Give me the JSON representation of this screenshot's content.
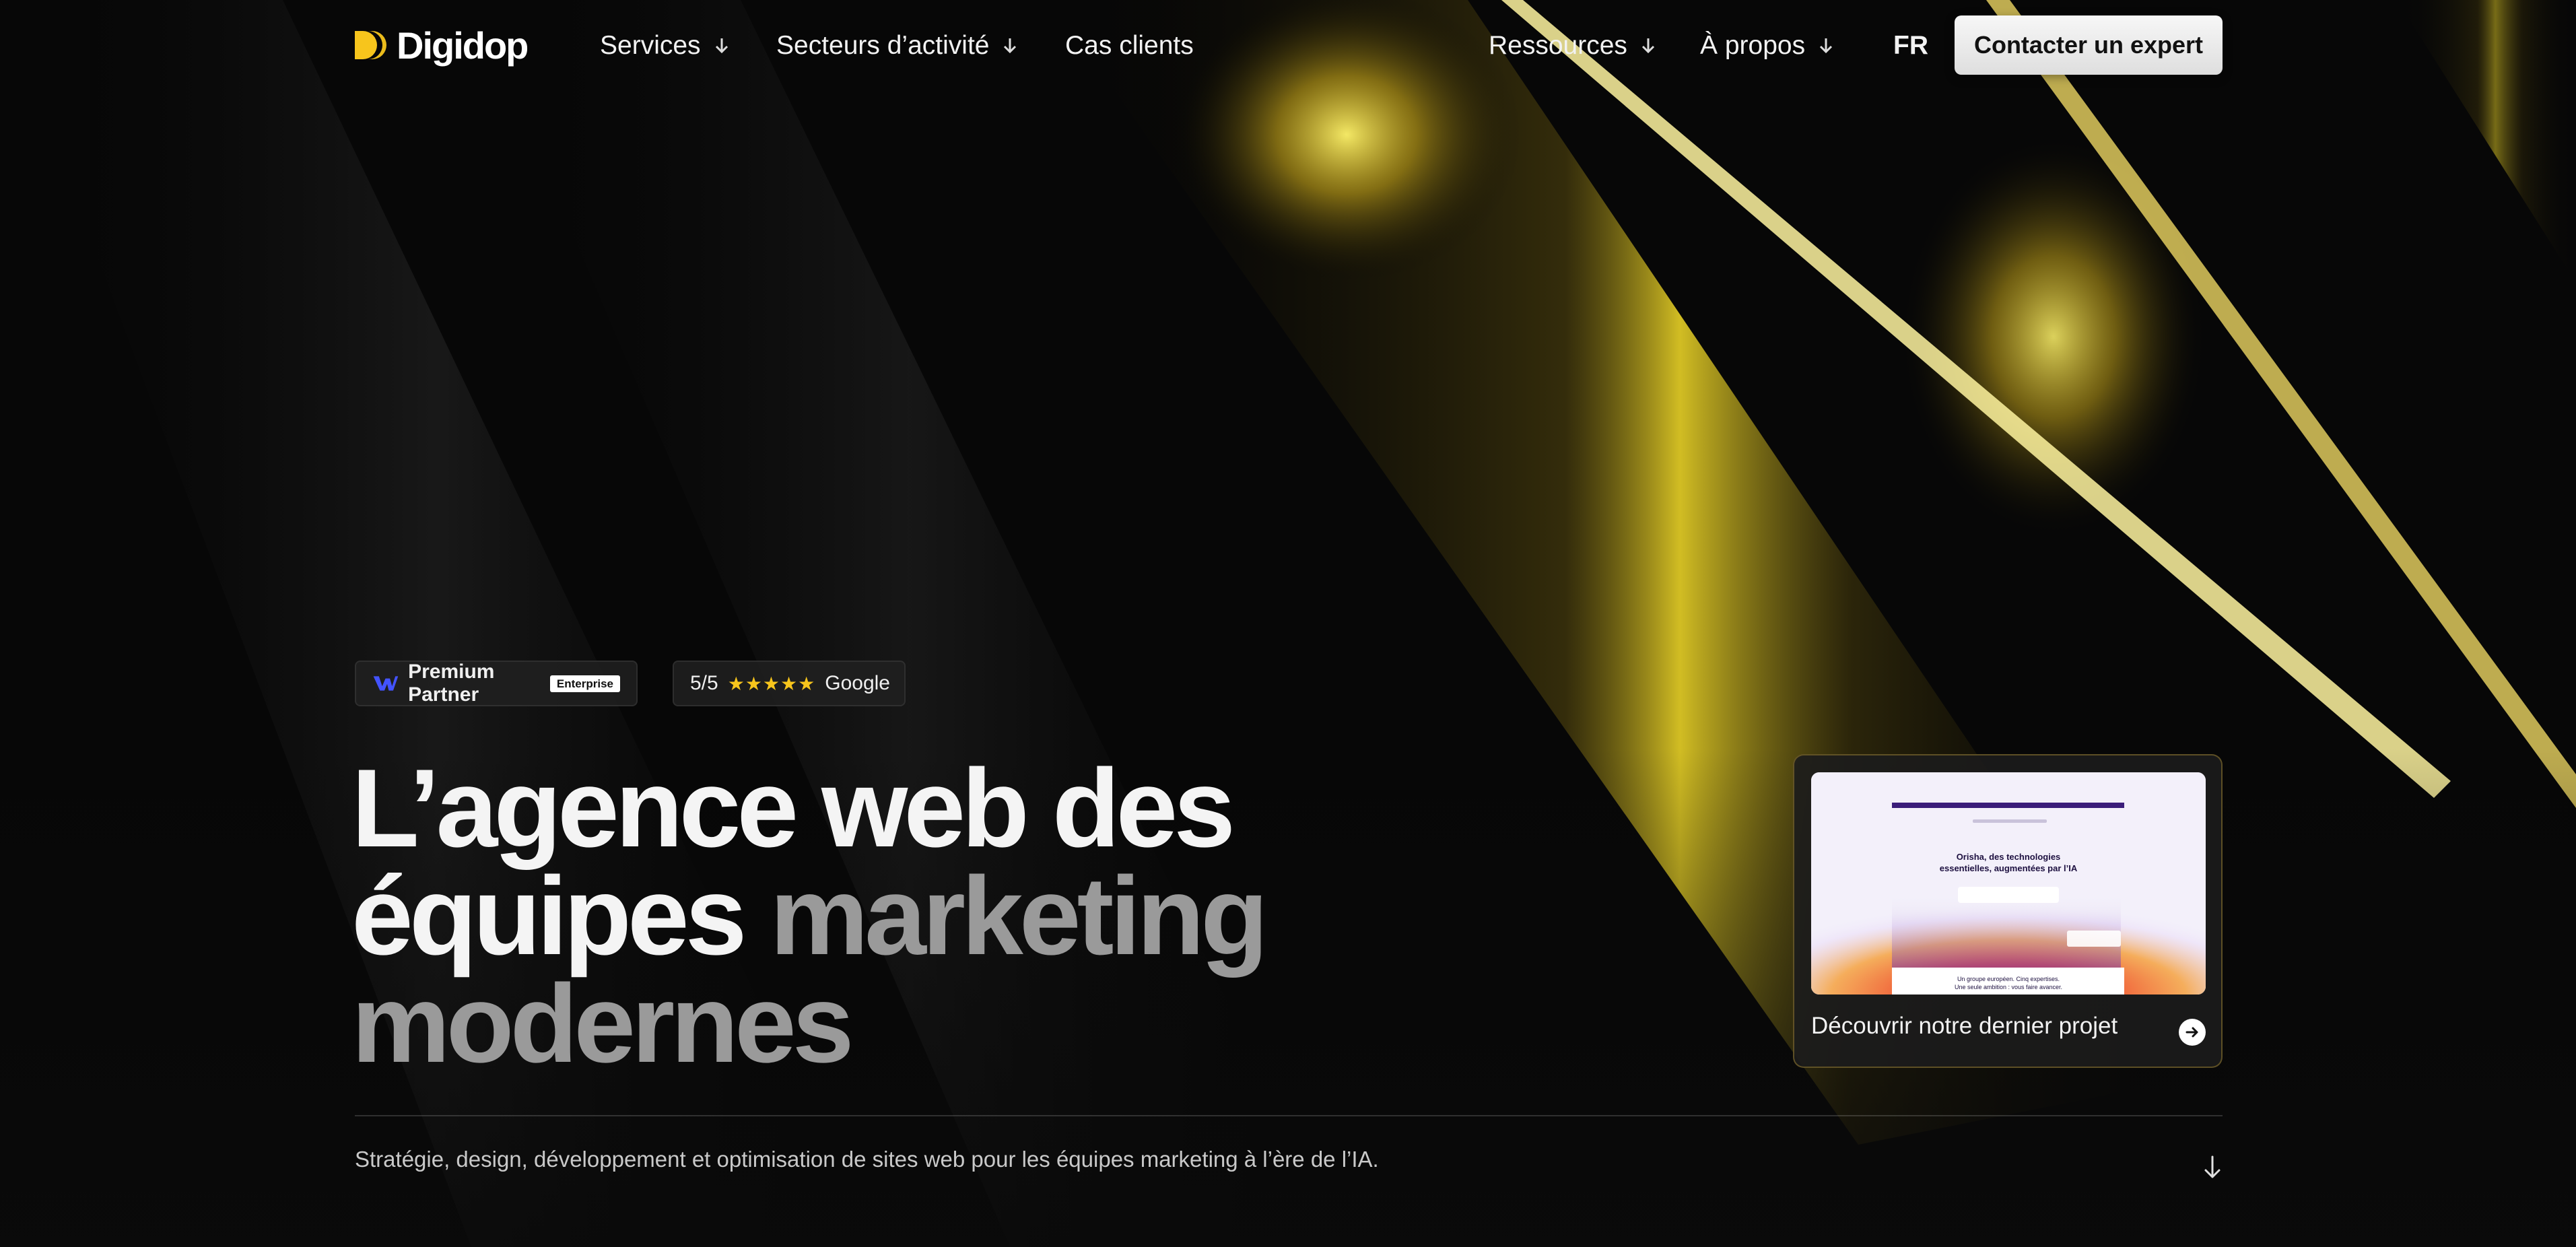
{
  "brand": {
    "name": "Digidop"
  },
  "nav": {
    "services": "Services",
    "secteurs": "Secteurs d’activité",
    "cas_clients": "Cas clients",
    "ressources": "Ressources",
    "a_propos": "À propos",
    "lang": "FR",
    "cta": "Contacter un expert"
  },
  "badges": {
    "partner": {
      "label": "Premium Partner",
      "tag": "Enterprise",
      "icon": "webflow-icon"
    },
    "rating": {
      "score": "5/5",
      "stars": "★★★★★",
      "source": "Google"
    }
  },
  "hero": {
    "line1": "L’agence web des",
    "line2_white": "équipes",
    "line2_grey": "marketing",
    "line3": "modernes",
    "subtitle": "Stratégie, design, développement et optimisation de sites web pour les équipes marketing à l’ère de l’IA."
  },
  "project_card": {
    "label": "Découvrir notre dernier projet",
    "preview_title_1": "Orisha, des technologies",
    "preview_title_2": "essentielles, augmentées par l’IA",
    "preview_footer_1": "Un groupe européen. Cinq expertises.",
    "preview_footer_2": "Une seule ambition : vous faire avancer."
  },
  "colors": {
    "background": "#0a0a0a",
    "accent_gold": "#f7c51c",
    "cta_bg": "#efefef",
    "headline_grey": "#9a9a9a"
  }
}
